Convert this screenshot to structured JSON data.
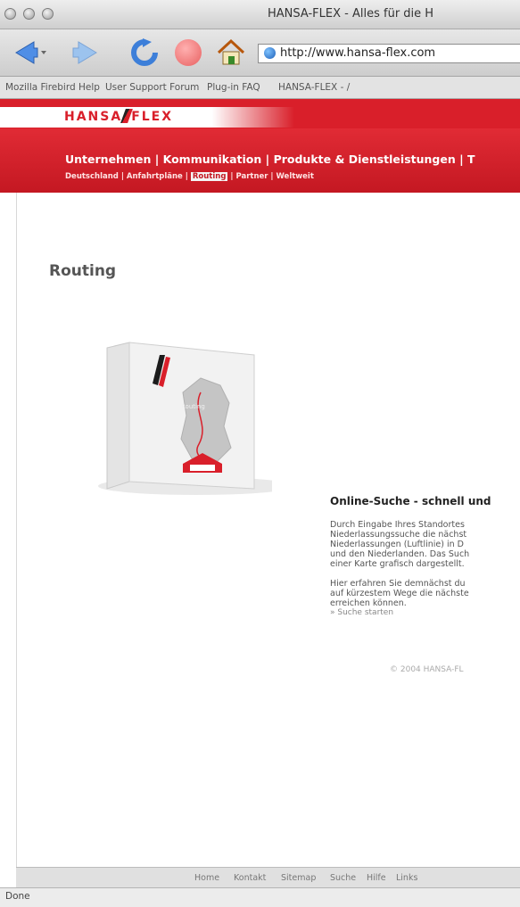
{
  "window": {
    "title": "HANSA-FLEX - Alles für die H"
  },
  "toolbar": {
    "url": "http://www.hansa-flex.com"
  },
  "bookmarks": [
    "Mozilla Firebird Help",
    "User Support Forum",
    "Plug-in FAQ",
    "HANSA-FLEX - /"
  ],
  "site": {
    "logo": "HANSA FLEX",
    "nav_main": "Unternehmen | Kommunikation | Produkte & Dienstleistungen | T",
    "nav_sub": {
      "before": "Deutschland | Anfahrtpläne |",
      "active": "Routing",
      "after": "| Partner | Weltweit"
    }
  },
  "content": {
    "page_title": "Routing",
    "headline": "Online-Suche - schnell und",
    "paragraph1": [
      "Durch Eingabe Ihres Standortes",
      "Niederlassungssuche die nächst",
      "Niederlassungen (Luftlinie) in D",
      "und den Niederlanden. Das Such",
      "einer Karte grafisch dargestellt."
    ],
    "paragraph2": [
      "Hier erfahren Sie demnächst du",
      "auf kürzestem Wege die nächste",
      "erreichen können."
    ],
    "search_link": "» Suche starten",
    "copyright": "© 2004 HANSA-FL",
    "box_label": "Routing"
  },
  "footer": {
    "links": [
      "Home",
      "Kontakt",
      "Sitemap",
      "Suche",
      "Hilfe",
      "Links"
    ]
  },
  "status": {
    "text": "Done"
  },
  "colors": {
    "brand_red": "#d91f2a"
  }
}
